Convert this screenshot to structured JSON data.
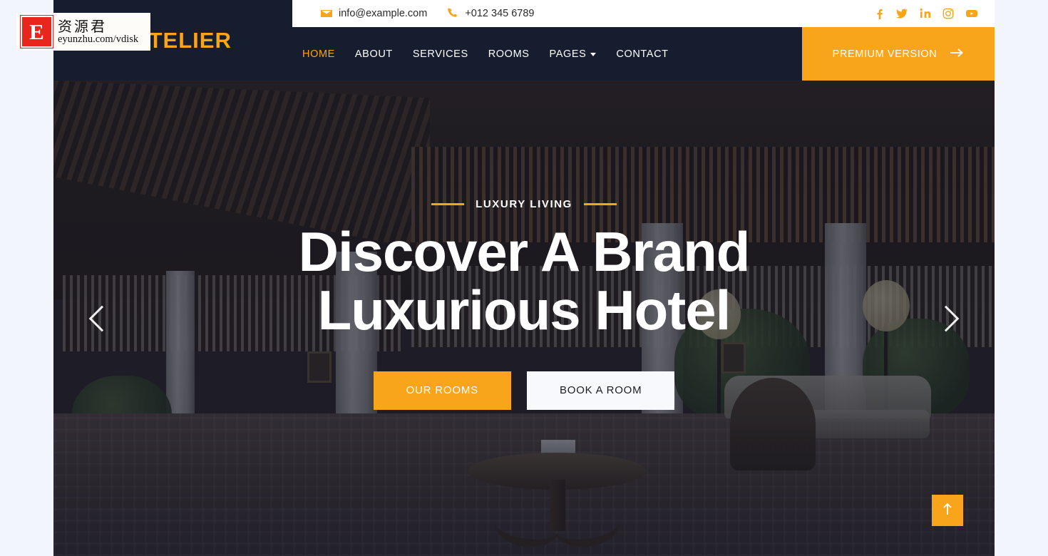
{
  "brand": {
    "logo_text": "HOTELIER"
  },
  "topbar": {
    "email": "info@example.com",
    "phone": "+012 345 6789",
    "email_icon": "envelope-icon",
    "phone_icon": "phone-icon",
    "socials": [
      {
        "name": "facebook-icon",
        "label": "f"
      },
      {
        "name": "twitter-icon",
        "label": "t"
      },
      {
        "name": "linkedin-icon",
        "label": "in"
      },
      {
        "name": "instagram-icon",
        "label": "ig"
      },
      {
        "name": "youtube-icon",
        "label": "yt"
      }
    ]
  },
  "nav": {
    "items": [
      {
        "label": "HOME",
        "active": true,
        "dropdown": false
      },
      {
        "label": "ABOUT",
        "active": false,
        "dropdown": false
      },
      {
        "label": "SERVICES",
        "active": false,
        "dropdown": false
      },
      {
        "label": "ROOMS",
        "active": false,
        "dropdown": false
      },
      {
        "label": "PAGES",
        "active": false,
        "dropdown": true
      },
      {
        "label": "CONTACT",
        "active": false,
        "dropdown": false
      }
    ],
    "premium_label": "PREMIUM VERSION",
    "premium_icon": "arrow-right-icon"
  },
  "hero": {
    "eyebrow": "LUXURY LIVING",
    "title_line1": "Discover A Brand",
    "title_line2": "Luxurious Hotel",
    "primary_button": "OUR ROOMS",
    "secondary_button": "BOOK A ROOM",
    "prev_icon": "chevron-left-icon",
    "next_icon": "chevron-right-icon"
  },
  "back_to_top": {
    "icon": "arrow-up-icon"
  },
  "watermark": {
    "logo_letter": "E",
    "brand_cn": "资源君",
    "url": "eyunzhu.com/vdisk"
  },
  "colors": {
    "accent": "#f8a51b",
    "header_dark": "#151d2e",
    "page_bg": "#f2f6fc",
    "light_button": "#f7f9fc"
  }
}
